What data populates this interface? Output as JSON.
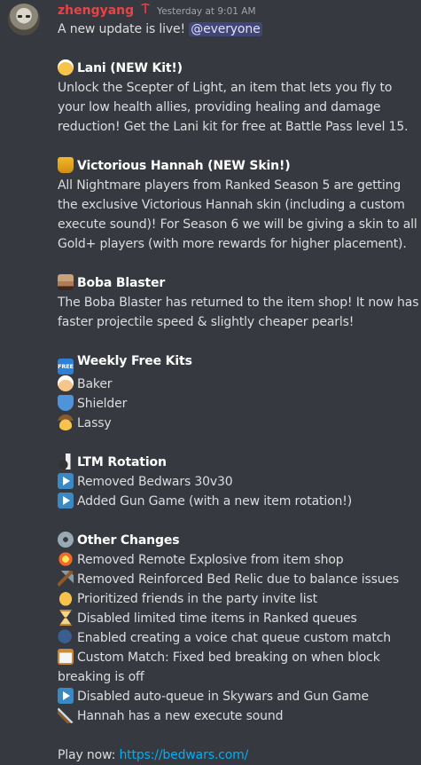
{
  "message": {
    "username": "zhengyang",
    "timestamp": "Yesterday at 9:01 AM",
    "intro_text": "A new update is live!",
    "mention": "@everyone",
    "lani_title": "Lani (NEW Kit!)",
    "lani_body_1": "Unlock the Scepter of Light, an item that lets you fly to",
    "lani_body_2": "your low health allies, providing healing and damage",
    "lani_body_3": "reduction! Get the Lani kit for free at Battle Pass level 15.",
    "hannah_title": "Victorious Hannah (NEW Skin!)",
    "hannah_body_1": "All Nightmare players from Ranked Season 5 are getting",
    "hannah_body_2": "the exclusive Victorious Hannah skin (including a custom",
    "hannah_body_3": "execute sound)! For Season 6 we will be giving a skin to all",
    "hannah_body_4": "Gold+ players (with more rewards for higher placement).",
    "boba_title": "Boba Blaster",
    "boba_body_1": "The Boba Blaster has returned to the item shop! It now has",
    "boba_body_2": "faster projectile speed & slightly cheaper pearls!",
    "free_title": "Weekly Free Kits",
    "free_kits": [
      "Baker",
      "Shielder",
      "Lassy"
    ],
    "ltm_title": "LTM Rotation",
    "ltm_items": [
      "Removed Bedwars 30v30",
      "Added Gun Game (with a new item rotation!)"
    ],
    "other_title": "Other Changes",
    "other_items": [
      "Removed Remote Explosive from item shop",
      "Removed Reinforced Bed Relic due to balance issues",
      "Prioritized friends in the party invite list",
      "Disabled limited time items in Ranked queues",
      "Enabled creating a voice chat queue custom match",
      "Custom Match: Fixed bed breaking on when block",
      "breaking is off",
      "Disabled auto-queue in Skywars and Gun Game",
      "Hannah has a new execute sound"
    ],
    "play_label": "Play now:",
    "play_link": "https://bedwars.com/"
  },
  "icons": {
    "free_badge": "FREE"
  },
  "colors": {
    "background": "#36393f",
    "username": "#ed4245",
    "link": "#00aff4",
    "mention_bg": "#414675"
  }
}
